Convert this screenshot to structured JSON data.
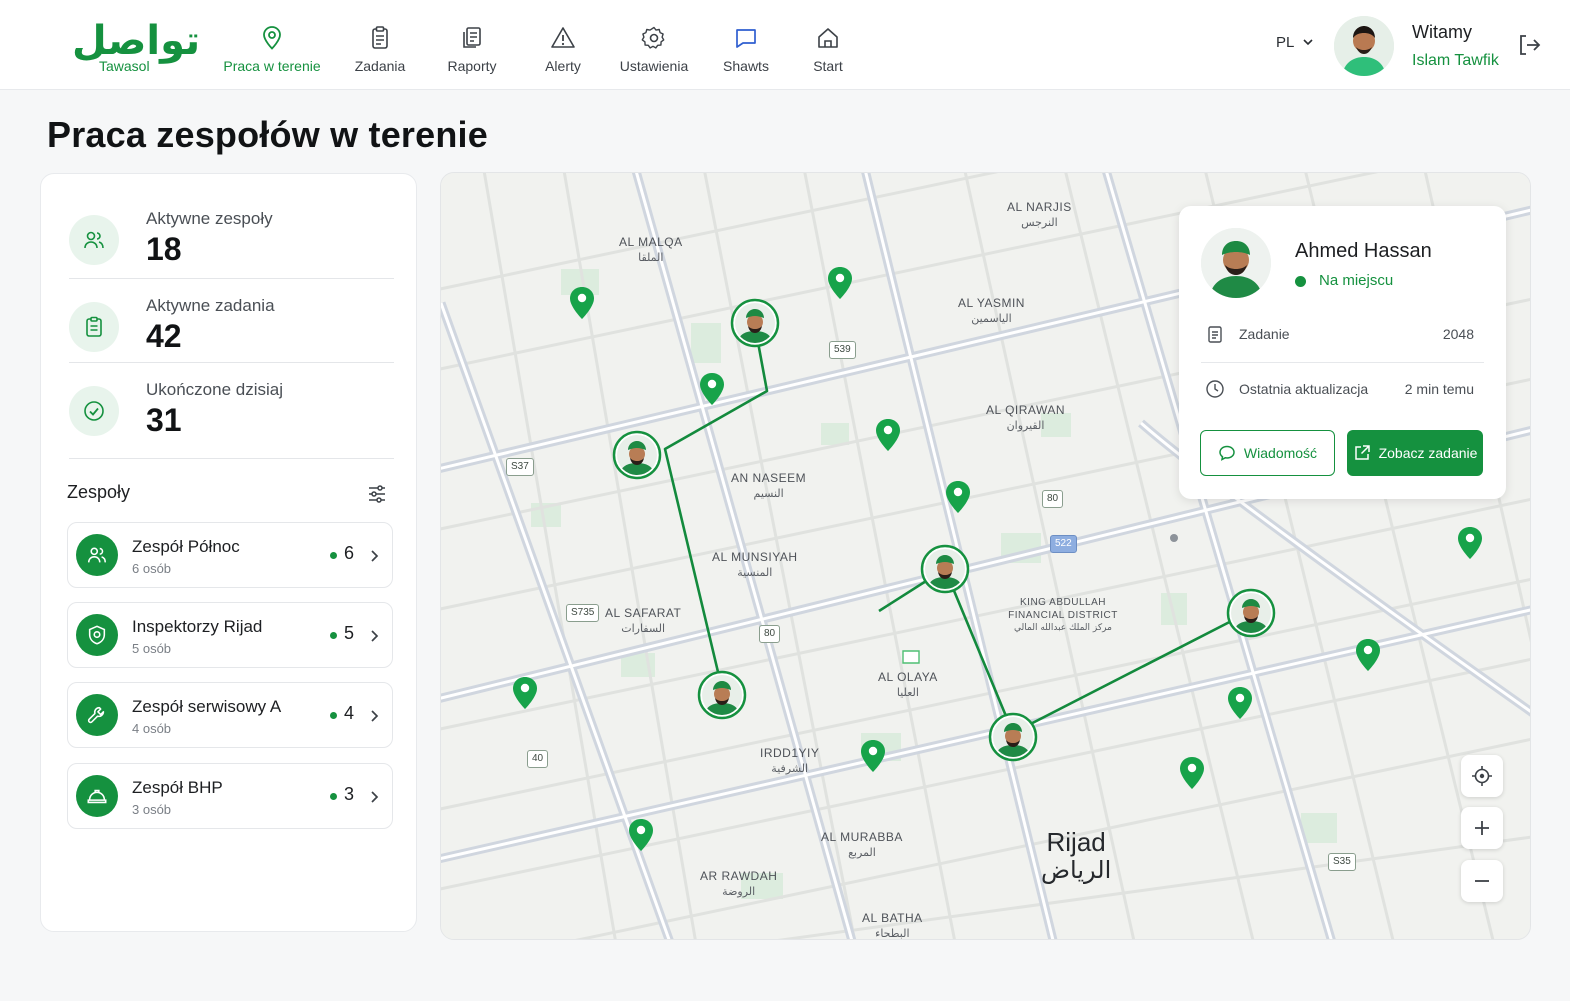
{
  "brand": {
    "logo_ar": "تواصل",
    "logo_en": "Tawasol",
    "accent": "#15913f"
  },
  "nav": [
    {
      "label": "Praca w terenie",
      "icon": "map-pin-icon",
      "active": true
    },
    {
      "label": "Zadania",
      "icon": "clipboard-icon"
    },
    {
      "label": "Raporty",
      "icon": "report-icon"
    },
    {
      "label": "Alerty",
      "icon": "warning-icon"
    },
    {
      "label": "Ustawienia",
      "icon": "gear-icon"
    },
    {
      "label": "Shawts",
      "icon": "chat-icon"
    },
    {
      "label": "Start",
      "icon": "home-icon"
    }
  ],
  "header": {
    "language": "PL",
    "welcome": "Witamy",
    "user_name": "Islam Tawfik"
  },
  "page_title": "Praca zespołów w terenie",
  "stats": [
    {
      "label": "Aktywne zespoły",
      "value": "18",
      "icon": "users-icon"
    },
    {
      "label": "Aktywne zadania",
      "value": "42",
      "icon": "clipboard-icon"
    },
    {
      "label": "Ukończone dzisiaj",
      "value": "31",
      "icon": "check-circle-icon"
    }
  ],
  "teams_title": "Zespoły",
  "teams": [
    {
      "name": "Zespół Północ",
      "members": "6 osób",
      "count": "6",
      "icon": "users-icon"
    },
    {
      "name": "Inspektorzy Rijad",
      "members": "5 osób",
      "count": "5",
      "icon": "shield-icon"
    },
    {
      "name": "Zespół serwisowy A",
      "members": "4 osób",
      "count": "4",
      "icon": "wrench-icon"
    },
    {
      "name": "Zespół BHP",
      "members": "3 osób",
      "count": "3",
      "icon": "helmet-icon"
    }
  ],
  "map": {
    "districts": [
      {
        "en": "AL NARJIS",
        "ar": "النرجس"
      },
      {
        "en": "AL MALQA",
        "ar": "الملقا"
      },
      {
        "en": "AL YASMIN",
        "ar": "الياسمين"
      },
      {
        "en": "AL QIRAWAN",
        "ar": "القيروان"
      },
      {
        "en": "AN NASEEM",
        "ar": "النسيم"
      },
      {
        "en": "AL MUNSIYAH",
        "ar": "المنسية"
      },
      {
        "en": "AL SAFARAT",
        "ar": "السفارات"
      },
      {
        "en": "KING ABDULLAH FINANCIAL DISTRICT",
        "ar": "مركز الملك عبدالله المالي"
      },
      {
        "en": "AL OLAYA",
        "ar": "العليا"
      },
      {
        "en": "IRDD1YIY",
        "ar": "الشرفية"
      },
      {
        "en": "AL MURABBA",
        "ar": "المربع"
      },
      {
        "en": "AR RAWDAH",
        "ar": "الروضة"
      },
      {
        "en": "AL BATHA",
        "ar": "البطحاء"
      }
    ],
    "city": {
      "en": "Rijad",
      "ar": "الرياض"
    },
    "shields": [
      "539",
      "S37",
      "80",
      "522",
      "S735",
      "80",
      "40",
      "S35"
    ]
  },
  "card": {
    "name": "Ahmed Hassan",
    "status": "Na miejscu",
    "task_label": "Zadanie",
    "task_value": "2048",
    "update_label": "Ostatnia aktualizacja",
    "update_value": "2 min temu",
    "btn_message": "Wiadomość",
    "btn_view": "Zobacz zadanie"
  }
}
